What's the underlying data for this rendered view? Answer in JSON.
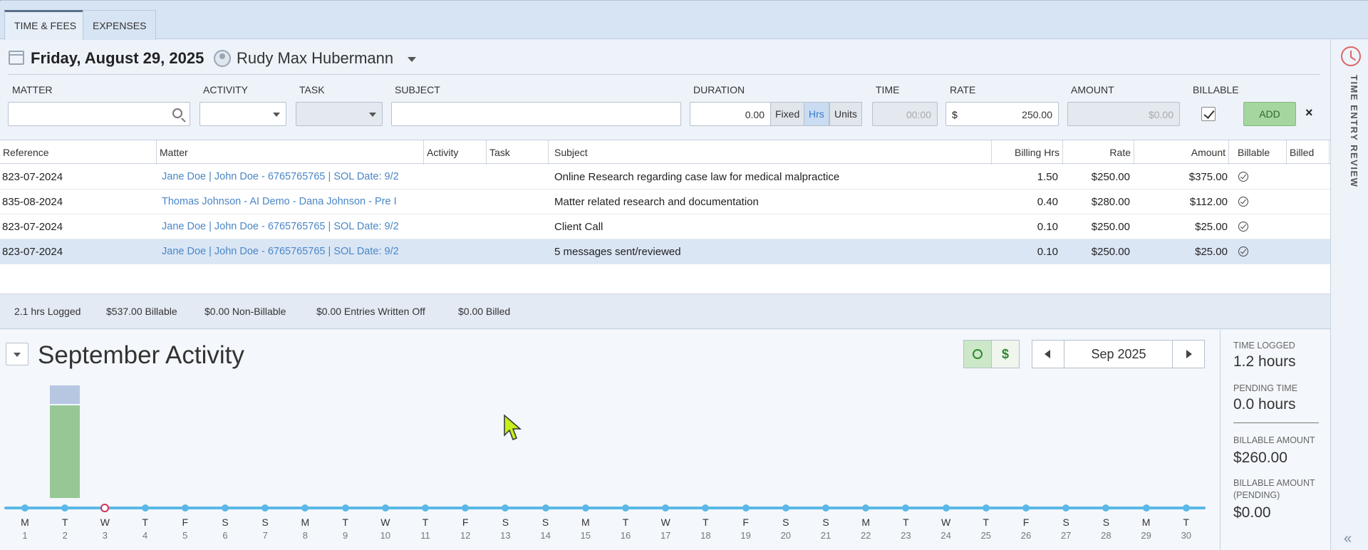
{
  "tabs": [
    {
      "label": "TIME & FEES",
      "active": true
    },
    {
      "label": "EXPENSES",
      "active": false
    }
  ],
  "review_panel": {
    "label": "TIME ENTRY REVIEW"
  },
  "header": {
    "date": "Friday, August 29, 2025",
    "user": "Rudy Max Hubermann"
  },
  "form": {
    "labels": {
      "matter": "MATTER",
      "activity": "ACTIVITY",
      "task": "TASK",
      "subject": "SUBJECT",
      "duration": "DURATION",
      "time": "TIME",
      "rate": "RATE",
      "amount": "AMOUNT",
      "billable": "BILLABLE"
    },
    "duration_value": "0.00",
    "duration_modes": [
      "Fixed",
      "Hrs",
      "Units"
    ],
    "duration_mode_selected": "Hrs",
    "time_value": "00:00",
    "rate_currency": "$",
    "rate_value": "250.00",
    "amount_value": "$0.00",
    "billable_checked": true,
    "add_label": "ADD",
    "close_label": "×"
  },
  "table": {
    "columns": [
      "Reference",
      "Matter",
      "Activity",
      "Task",
      "Subject",
      "Billing Hrs",
      "Rate",
      "Amount",
      "Billable",
      "Billed"
    ],
    "rows": [
      {
        "reference": "823-07-2024",
        "matter": "Jane Doe | John Doe - 6765765765 | SOL Date: 9/2",
        "activity": "",
        "task": "",
        "subject": "Online Research regarding case law for medical malpractice",
        "hours": "1.50",
        "rate": "$250.00",
        "amount": "$375.00",
        "billable": true,
        "billed": false,
        "selected": false
      },
      {
        "reference": "835-08-2024",
        "matter": "Thomas Johnson - AI Demo - Dana Johnson - Pre I",
        "activity": "",
        "task": "",
        "subject": "Matter related research and documentation",
        "hours": "0.40",
        "rate": "$280.00",
        "amount": "$112.00",
        "billable": true,
        "billed": false,
        "selected": false
      },
      {
        "reference": "823-07-2024",
        "matter": "Jane Doe | John Doe - 6765765765 | SOL Date: 9/2",
        "activity": "",
        "task": "",
        "subject": "Client Call",
        "hours": "0.10",
        "rate": "$250.00",
        "amount": "$25.00",
        "billable": true,
        "billed": false,
        "selected": false
      },
      {
        "reference": "823-07-2024",
        "matter": "Jane Doe | John Doe - 6765765765 | SOL Date: 9/2",
        "activity": "",
        "task": "",
        "subject": "5 messages sent/reviewed",
        "hours": "0.10",
        "rate": "$250.00",
        "amount": "$25.00",
        "billable": true,
        "billed": false,
        "selected": true
      }
    ]
  },
  "summary": {
    "logged": "2.1 hrs Logged",
    "billable": "$537.00 Billable",
    "non_billable": "$0.00 Non-Billable",
    "written_off": "$0.00 Entries Written Off",
    "billed": "$0.00 Billed"
  },
  "activity": {
    "title": "September Activity",
    "dollar_label": "$",
    "month": "Sep 2025",
    "today_index": 2,
    "days": [
      {
        "letter": "M",
        "num": "1"
      },
      {
        "letter": "T",
        "num": "2"
      },
      {
        "letter": "W",
        "num": "3"
      },
      {
        "letter": "T",
        "num": "4"
      },
      {
        "letter": "F",
        "num": "5"
      },
      {
        "letter": "S",
        "num": "6"
      },
      {
        "letter": "S",
        "num": "7"
      },
      {
        "letter": "M",
        "num": "8"
      },
      {
        "letter": "T",
        "num": "9"
      },
      {
        "letter": "W",
        "num": "10"
      },
      {
        "letter": "T",
        "num": "11"
      },
      {
        "letter": "F",
        "num": "12"
      },
      {
        "letter": "S",
        "num": "13"
      },
      {
        "letter": "S",
        "num": "14"
      },
      {
        "letter": "M",
        "num": "15"
      },
      {
        "letter": "T",
        "num": "16"
      },
      {
        "letter": "W",
        "num": "17"
      },
      {
        "letter": "T",
        "num": "18"
      },
      {
        "letter": "F",
        "num": "19"
      },
      {
        "letter": "S",
        "num": "20"
      },
      {
        "letter": "S",
        "num": "21"
      },
      {
        "letter": "M",
        "num": "22"
      },
      {
        "letter": "T",
        "num": "23"
      },
      {
        "letter": "W",
        "num": "24"
      },
      {
        "letter": "T",
        "num": "25"
      },
      {
        "letter": "F",
        "num": "26"
      },
      {
        "letter": "S",
        "num": "27"
      },
      {
        "letter": "S",
        "num": "28"
      },
      {
        "letter": "M",
        "num": "29"
      },
      {
        "letter": "T",
        "num": "30"
      }
    ],
    "bars": [
      {
        "day": "2",
        "logged_hours": 1.0,
        "pending_hours": 0.2
      }
    ],
    "colors": {
      "logged": "#96c795",
      "pending": "#b7c7e2",
      "timeline": "#5bb8e6",
      "today": "#d0335e"
    }
  },
  "stats": [
    {
      "label": "TIME LOGGED",
      "value": "1.2 hours"
    },
    {
      "label": "PENDING TIME",
      "value": "0.0 hours"
    },
    {
      "label": "BILLABLE AMOUNT",
      "value": "$260.00"
    },
    {
      "label": "BILLABLE AMOUNT (PENDING)",
      "value": "$0.00"
    }
  ]
}
